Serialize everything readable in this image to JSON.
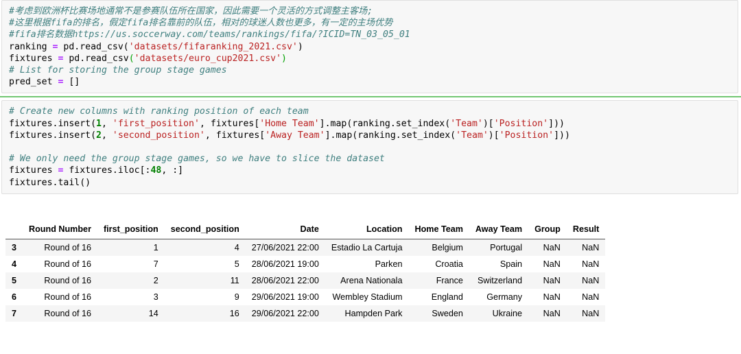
{
  "notebook": {
    "cells": [
      {
        "id": "cell-1",
        "lines": [
          [
            {
              "t": "#考虑到欧洲杯比赛场地通常不是参赛队伍所在国家，因此需要一个灵活的方式调整主客场;",
              "k": "c"
            }
          ],
          [
            {
              "t": "#这里根据fifa的排名，假定fifa排名靠前的队伍，相对的球迷人数也更多，有一定的主场优势",
              "k": "c"
            }
          ],
          [
            {
              "t": "#fifa排名数据https://us.soccerway.com/teams/rankings/fifa/?ICID=TN_03_05_01",
              "k": "c"
            }
          ],
          [
            {
              "t": "ranking ",
              "k": "pl"
            },
            {
              "t": "=",
              "k": "op"
            },
            {
              "t": " pd.read_csv(",
              "k": "pl"
            },
            {
              "t": "'datasets/fifaranking_2021.csv'",
              "k": "s"
            },
            {
              "t": ")",
              "k": "pl"
            }
          ],
          [
            {
              "t": "fixtures ",
              "k": "pl"
            },
            {
              "t": "=",
              "k": "op"
            },
            {
              "t": " pd.read_csv",
              "k": "pl"
            },
            {
              "t": "(",
              "k": "pg"
            },
            {
              "t": "'datasets/euro_cup2021.csv'",
              "k": "s"
            },
            {
              "t": ")",
              "k": "pg"
            }
          ],
          [
            {
              "t": "# List for storing the group stage games",
              "k": "c"
            }
          ],
          [
            {
              "t": "pred_set ",
              "k": "pl"
            },
            {
              "t": "=",
              "k": "op"
            },
            {
              "t": " []",
              "k": "pl"
            }
          ]
        ]
      },
      {
        "id": "cell-2",
        "lines": [
          [
            {
              "t": "# Create new columns with ranking position of each team",
              "k": "c"
            }
          ],
          [
            {
              "t": "fixtures.insert(",
              "k": "pl"
            },
            {
              "t": "1",
              "k": "n"
            },
            {
              "t": ", ",
              "k": "pl"
            },
            {
              "t": "'first_position'",
              "k": "s"
            },
            {
              "t": ", fixtures[",
              "k": "pl"
            },
            {
              "t": "'Home Team'",
              "k": "s"
            },
            {
              "t": "].map(ranking.set_index(",
              "k": "pl"
            },
            {
              "t": "'Team'",
              "k": "s"
            },
            {
              "t": ")[",
              "k": "pl"
            },
            {
              "t": "'Position'",
              "k": "s"
            },
            {
              "t": "]))",
              "k": "pl"
            }
          ],
          [
            {
              "t": "fixtures.insert(",
              "k": "pl"
            },
            {
              "t": "2",
              "k": "n"
            },
            {
              "t": ", ",
              "k": "pl"
            },
            {
              "t": "'second_position'",
              "k": "s"
            },
            {
              "t": ", fixtures[",
              "k": "pl"
            },
            {
              "t": "'Away Team'",
              "k": "s"
            },
            {
              "t": "].map(ranking.set_index(",
              "k": "pl"
            },
            {
              "t": "'Team'",
              "k": "s"
            },
            {
              "t": ")[",
              "k": "pl"
            },
            {
              "t": "'Position'",
              "k": "s"
            },
            {
              "t": "]))",
              "k": "pl"
            }
          ],
          [
            {
              "t": " ",
              "k": "pl"
            }
          ],
          [
            {
              "t": "# We only need the group stage games, so we have to slice the dataset",
              "k": "c"
            }
          ],
          [
            {
              "t": "fixtures ",
              "k": "pl"
            },
            {
              "t": "=",
              "k": "op"
            },
            {
              "t": " fixtures.iloc[:",
              "k": "pl"
            },
            {
              "t": "48",
              "k": "n"
            },
            {
              "t": ", :]",
              "k": "pl"
            }
          ],
          [
            {
              "t": "fixtures.tail()",
              "k": "pl"
            }
          ]
        ]
      }
    ]
  },
  "output_table": {
    "index_header": "",
    "columns": [
      "Round Number",
      "first_position",
      "second_position",
      "Date",
      "Location",
      "Home Team",
      "Away Team",
      "Group",
      "Result"
    ],
    "index": [
      "3",
      "4",
      "5",
      "6",
      "7"
    ],
    "rows": [
      [
        "Round of 16",
        "1",
        "4",
        "27/06/2021 22:00",
        "Estadio La Cartuja",
        "Belgium",
        "Portugal",
        "NaN",
        "NaN"
      ],
      [
        "Round of 16",
        "7",
        "5",
        "28/06/2021 19:00",
        "Parken",
        "Croatia",
        "Spain",
        "NaN",
        "NaN"
      ],
      [
        "Round of 16",
        "2",
        "11",
        "28/06/2021 22:00",
        "Arena Nationala",
        "France",
        "Switzerland",
        "NaN",
        "NaN"
      ],
      [
        "Round of 16",
        "3",
        "9",
        "29/06/2021 19:00",
        "Wembley Stadium",
        "England",
        "Germany",
        "NaN",
        "NaN"
      ],
      [
        "Round of 16",
        "14",
        "16",
        "29/06/2021 22:00",
        "Hampden Park",
        "Sweden",
        "Ukraine",
        "NaN",
        "NaN"
      ]
    ]
  },
  "colors": {
    "comment": "#3f7f7f",
    "string": "#ba2121",
    "number": "#008000",
    "operator": "#aa22ff",
    "cell_background": "#f7f7f7",
    "cell_border": "#dfdfdf",
    "selected_cell_bar": "#71c671",
    "table_row_alt": "#f5f5f5",
    "table_rule": "#555555"
  }
}
